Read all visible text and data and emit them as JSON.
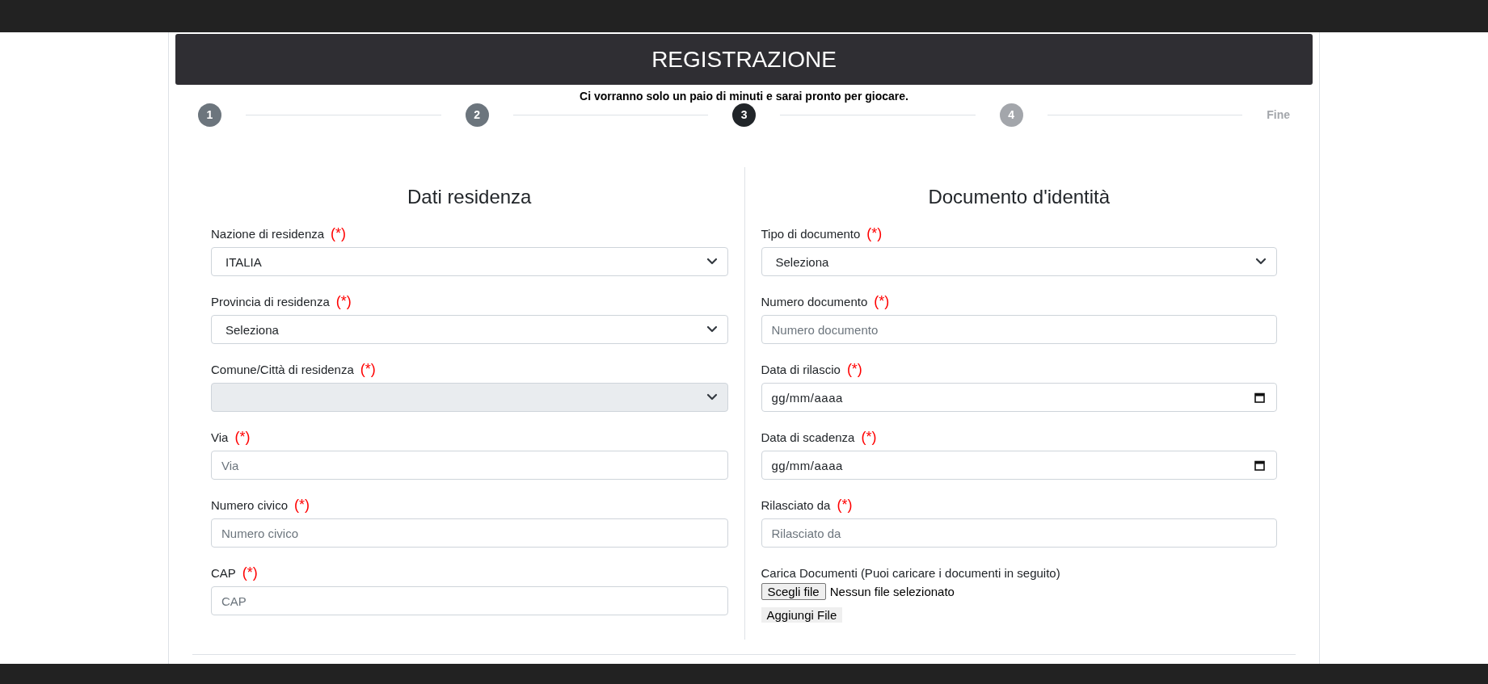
{
  "header": {
    "title": "REGISTRAZIONE"
  },
  "subtitle": "Ci vorranno solo un paio di minuti e sarai pronto per giocare.",
  "steps": [
    {
      "label": "1",
      "kind": "circle",
      "completed": true,
      "current": false
    },
    {
      "label": "2",
      "kind": "circle",
      "completed": true,
      "current": false
    },
    {
      "label": "3",
      "kind": "circle",
      "completed": false,
      "current": true
    },
    {
      "label": "4",
      "kind": "circle",
      "completed": false,
      "current": false
    },
    {
      "label": "Fine",
      "kind": "text",
      "completed": false,
      "current": false
    }
  ],
  "sections": [
    {
      "title": "Dati residenza",
      "fields": [
        {
          "kind": "select",
          "label": "Nazione di residenza",
          "required_mark": "(*)",
          "value": "ITALIA",
          "disabled": false
        },
        {
          "kind": "select",
          "label": "Provincia di residenza",
          "required_mark": "(*)",
          "value": "Seleziona",
          "disabled": false
        },
        {
          "kind": "select",
          "label": "Comune/Città di residenza",
          "required_mark": "(*)",
          "disabled": true
        },
        {
          "kind": "text",
          "label": "Via",
          "required_mark": "(*)",
          "placeholder": "Via"
        },
        {
          "kind": "text",
          "label": "Numero civico",
          "required_mark": "(*)",
          "placeholder": "Numero civico"
        },
        {
          "kind": "text",
          "label": "CAP",
          "required_mark": "(*)",
          "placeholder": "CAP"
        }
      ]
    },
    {
      "title": "Documento d'identità",
      "fields": [
        {
          "kind": "select",
          "label": "Tipo di documento",
          "required_mark": "(*)",
          "value": "Seleziona",
          "disabled": false
        },
        {
          "kind": "text",
          "label": "Numero documento",
          "required_mark": "(*)",
          "placeholder": "Numero documento"
        },
        {
          "kind": "date",
          "label": "Data di rilascio",
          "required_mark": "(*)",
          "placeholder": "gg/mm/aaaa"
        },
        {
          "kind": "date",
          "label": "Data di scadenza",
          "required_mark": "(*)",
          "placeholder": "gg/mm/aaaa"
        },
        {
          "kind": "text",
          "label": "Rilasciato da",
          "required_mark": "(*)",
          "placeholder": "Rilasciato da"
        },
        {
          "kind": "file",
          "label": "Carica Documenti (Puoi caricare i documenti in seguito)",
          "button": "Scegli file",
          "status": "Nessun file selezionato",
          "add_button": "Aggiungi File"
        }
      ]
    }
  ]
}
